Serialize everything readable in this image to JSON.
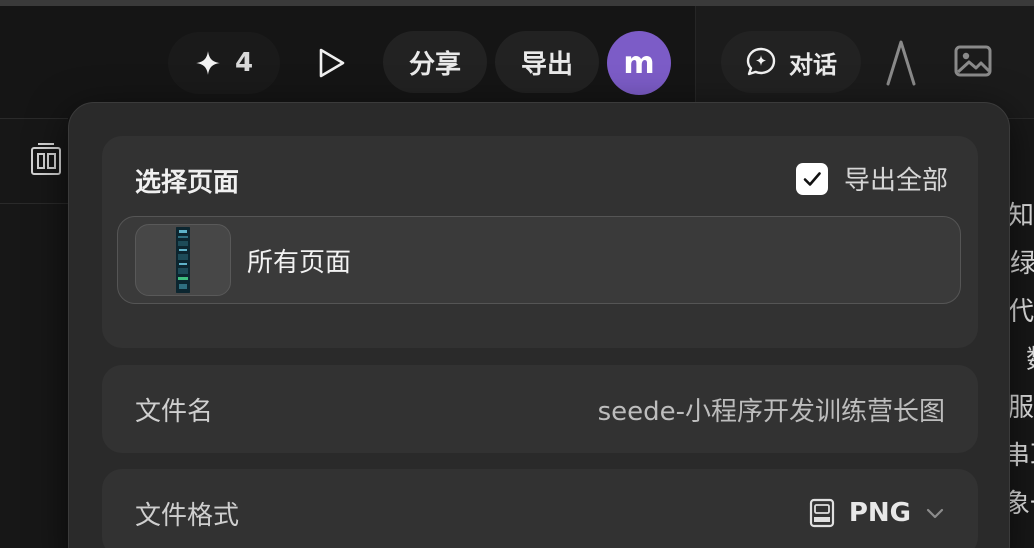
{
  "toolbar": {
    "ai_count": "4",
    "share_label": "分享",
    "export_label": "导出",
    "avatar_letter": "m",
    "chat_label": "对话",
    "icons": [
      "sparkle-icon",
      "play-icon",
      "chat-icon",
      "text-tool-icon",
      "image-icon",
      "panel-toggle-icon"
    ]
  },
  "export_panel": {
    "select_page_title": "选择页面",
    "export_all_label": "导出全部",
    "export_all_checked": true,
    "page_item_label": "所有页面",
    "filename_label": "文件名",
    "filename_value": "seede-小程序开发训练营长图",
    "format_label": "文件格式",
    "format_value": "PNG"
  },
  "side_text": [
    "知",
    "绿",
    "代",
    "数",
    "服",
    "串耳",
    "象一"
  ],
  "colors": {
    "avatar": "#7c5cc7",
    "popover_bg": "#2a2a2a",
    "card_bg": "#323232"
  }
}
